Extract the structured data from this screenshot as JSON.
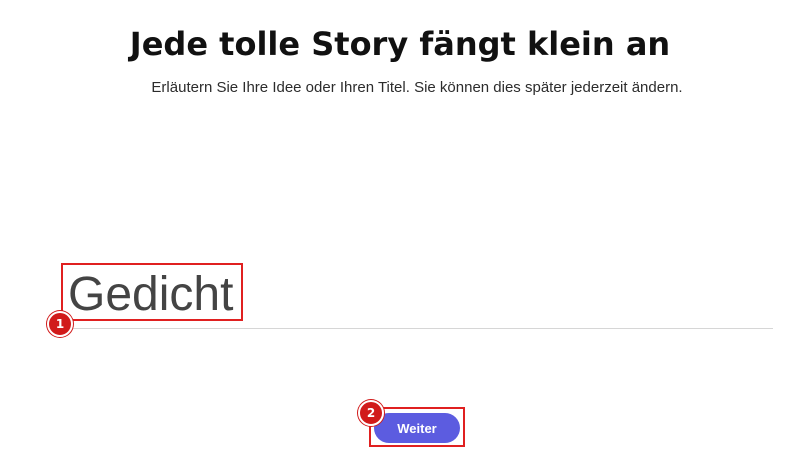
{
  "header": {
    "title": "Jede tolle Story fängt klein an",
    "subtitle": "Erläutern Sie Ihre Idee oder Ihren Titel. Sie können dies später jederzeit ändern."
  },
  "title_field": {
    "value": "Gedicht"
  },
  "actions": {
    "next_label": "Weiter"
  },
  "annotations": {
    "step_1": "1",
    "step_2": "2"
  },
  "colors": {
    "button": "#5c5ce0",
    "highlight": "#e02020",
    "badge": "#d11a1a"
  }
}
